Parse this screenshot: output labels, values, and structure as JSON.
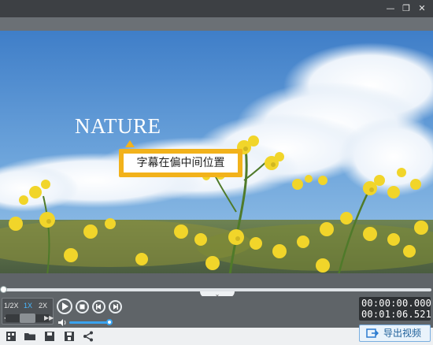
{
  "window": {
    "minimize_glyph": "—",
    "restore_glyph": "❐",
    "close_glyph": "✕"
  },
  "video": {
    "title_text": "NATURE",
    "subtitle_text": "字幕在偏中间位置"
  },
  "speed": {
    "options": [
      "1/2X",
      "1X",
      "2X"
    ],
    "selected": "1X"
  },
  "time": {
    "current": "00:00:00.000",
    "total": "00:01:06.521"
  },
  "volume": {
    "level": 0.93
  },
  "bottom_toolbar": {
    "icons": [
      "new-project-icon",
      "open-folder-icon",
      "save-icon",
      "save-as-icon",
      "share-icon"
    ],
    "export_label": "导出视频"
  },
  "colors": {
    "accent": "#3aa3ef",
    "subtitle_frame": "#f2b21b",
    "background": "#5f6468"
  }
}
